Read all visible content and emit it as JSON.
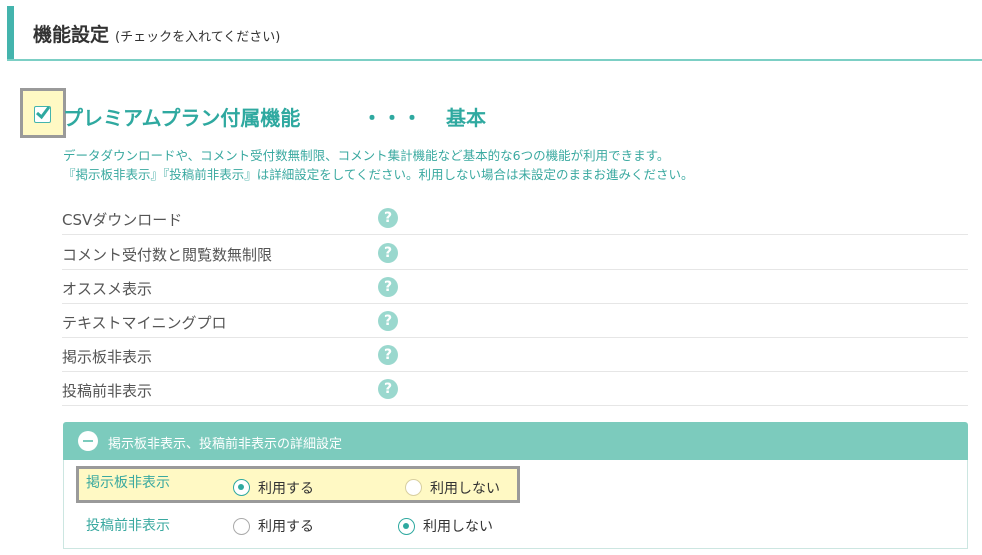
{
  "header": {
    "title": "機能設定",
    "subtitle": "(チェックを入れてください)"
  },
  "plan": {
    "checked": true,
    "title": "プレミアムプラン付属機能",
    "dots": "・・・",
    "grade": "基本",
    "description_1": "データダウンロードや、コメント受付数無制限、コメント集計機能など基本的な6つの機能が利用できます。",
    "description_2": "『掲示板非表示』『投稿前非表示』は詳細設定をしてください。利用しない場合は未設定のままお進みください。"
  },
  "features": [
    {
      "label": "CSVダウンロード",
      "help": "?"
    },
    {
      "label": "コメント受付数と閲覧数無制限",
      "help": "?"
    },
    {
      "label": "オススメ表示",
      "help": "?"
    },
    {
      "label": "テキストマイニングプロ",
      "help": "?"
    },
    {
      "label": "掲示板非表示",
      "help": "?"
    },
    {
      "label": "投稿前非表示",
      "help": "?"
    }
  ],
  "detail": {
    "title": "掲示板非表示、投稿前非表示の詳細設定",
    "rows": [
      {
        "label": "掲示板非表示",
        "option_use": "利用する",
        "option_no": "利用しない",
        "selected": "利用する"
      },
      {
        "label": "投稿前非表示",
        "option_use": "利用する",
        "option_no": "利用しない",
        "selected": "利用しない"
      }
    ]
  },
  "colors": {
    "accent": "#44b4ad",
    "accent_text": "#2fa9a0",
    "panel_header": "#7ccbbd",
    "highlight": "#fff9c4"
  }
}
